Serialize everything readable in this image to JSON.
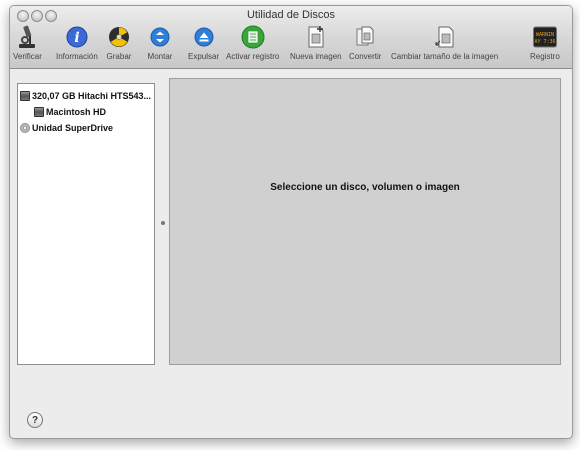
{
  "window": {
    "title": "Utilidad de Discos"
  },
  "toolbar": {
    "verify": "Verificar",
    "info": "Información",
    "burn": "Grabar",
    "mount": "Montar",
    "eject": "Expulsar",
    "enable_log": "Activar registro",
    "new_image": "Nueva imagen",
    "convert": "Convertir",
    "resize_image": "Cambiar tamaño de la imagen",
    "log": "Registro",
    "log_icon_text": "WARNIN AY 7:36"
  },
  "sidebar": {
    "items": [
      {
        "label": "320,07 GB Hitachi HTS543...",
        "icon": "hard-drive-icon"
      },
      {
        "label": "Macintosh HD",
        "icon": "volume-icon"
      },
      {
        "label": "Unidad SuperDrive",
        "icon": "optical-drive-icon"
      }
    ]
  },
  "main": {
    "message": "Seleccione un disco, volumen o imagen"
  },
  "footer": {
    "help": "?"
  },
  "colors": {
    "window_bg": "#ececec",
    "main_panel_bg": "#d0d0d0",
    "info_blue": "#3b6ad6",
    "button_blue": "#2f7fd8",
    "enable_log_green": "#3aa63a"
  }
}
